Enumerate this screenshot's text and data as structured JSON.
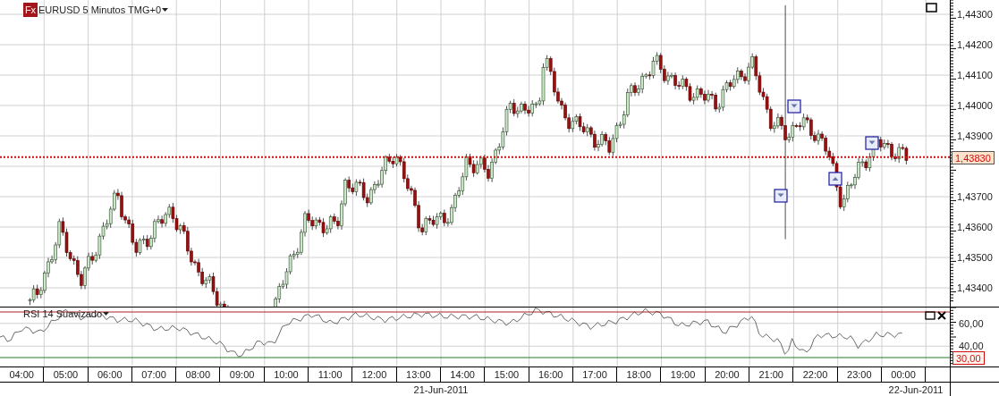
{
  "header": {
    "logo": "Fx",
    "title": "EURUSD 5 Minutos TMG+0"
  },
  "price_axis": {
    "ticks": [
      "1,44300",
      "1,44200",
      "1,44100",
      "1,44000",
      "1,43900",
      "1,43700",
      "1,43600",
      "1,43500",
      "1,43400"
    ],
    "current_price": "1,43830"
  },
  "trade_markers": [
    {
      "kind": "down"
    },
    {
      "kind": "down"
    },
    {
      "kind": "up"
    },
    {
      "kind": "down"
    }
  ],
  "indicator": {
    "title": "RSI 14 Suavizado",
    "ticks": [
      "60,00",
      "40,00"
    ],
    "level_label": "30,00"
  },
  "time_axis": {
    "labels": [
      "04:00",
      "05:00",
      "06:00",
      "07:00",
      "08:00",
      "09:00",
      "10:00",
      "11:00",
      "12:00",
      "13:00",
      "14:00",
      "15:00",
      "16:00",
      "17:00",
      "18:00",
      "19:00",
      "20:00",
      "21:00",
      "22:00",
      "23:00",
      "00:00"
    ],
    "dates": [
      "21-Jun-2011",
      "22-Jun-2011"
    ]
  }
}
